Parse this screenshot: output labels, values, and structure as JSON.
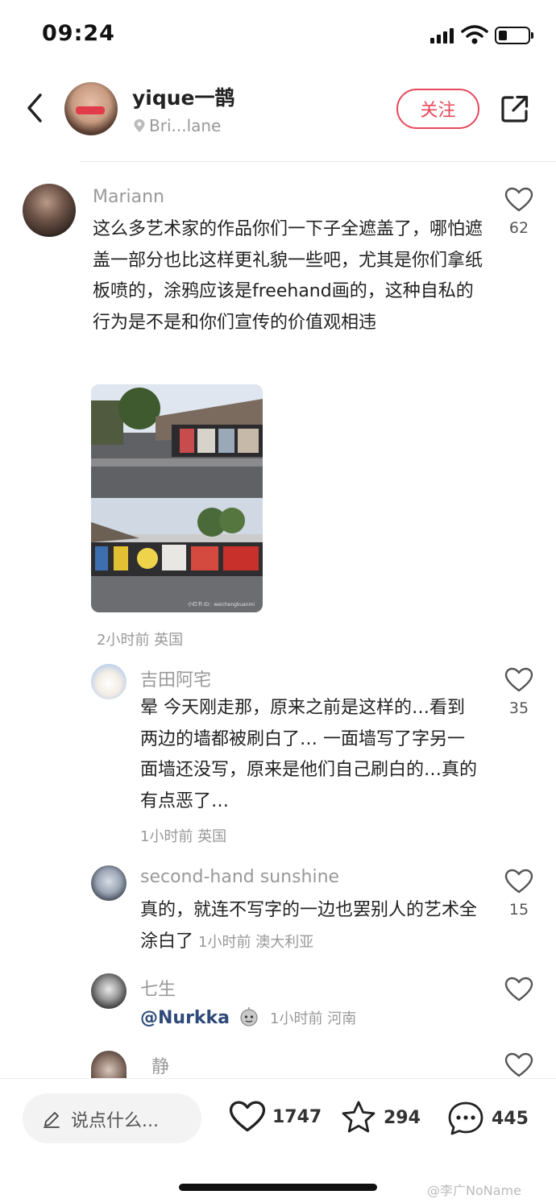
{
  "status_bar": {
    "time": "09:24"
  },
  "header": {
    "author_name": "yique一鹊",
    "location": "Bri...lane",
    "follow_label": "关注"
  },
  "comments": [
    {
      "name": "Mariann",
      "text": "这么多艺术家的作品你们一下子全遮盖了，哪怕遮盖一部分也比这样更礼貌一些吧，尤其是你们拿纸板喷的，涂鸦应该是freehand画的，这种自私的行为是不是和你们宣传的价值观相违",
      "meta": "2小时前 英国",
      "likes": "62",
      "image_watermark": "小红书 ID：weichengkuanmi"
    },
    {
      "name": "吉田阿宅",
      "text": "晕 今天刚走那，原来之前是这样的…看到两边的墙都被刷白了… 一面墙写了字另一面墙还没写，原来是他们自己刷白的…真的有点恶了…",
      "meta": "1小时前 英国",
      "likes": "35"
    },
    {
      "name": "second-hand sunshine",
      "text": "真的，就连不写字的一边也罢别人的艺术全涂白了",
      "meta": "1小时前 澳大利亚",
      "likes": "15"
    },
    {
      "name": "七生",
      "mention": "@Nurkka",
      "meta": "1小时前 河南",
      "likes": ""
    },
    {
      "name": "静",
      "likes": ""
    }
  ],
  "bottom_bar": {
    "input_placeholder": "说点什么...",
    "likes": "1747",
    "favorites": "294",
    "comments": "445"
  },
  "watermark": "@李广NoName",
  "colors": {
    "accent": "#e8485a",
    "mention": "#2f4a7a",
    "muted": "#999999"
  }
}
